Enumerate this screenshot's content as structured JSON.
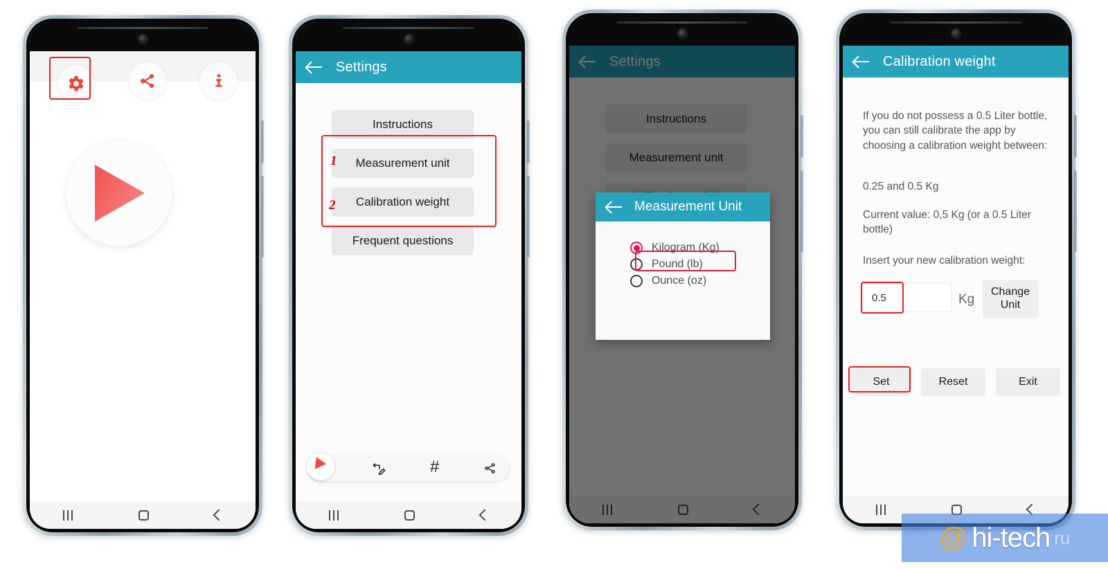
{
  "theme": {
    "teal": "#27a3bb",
    "teal_dim": "#1b5f6d",
    "accent_red": "#ef4a4a",
    "highlight_red": "#ee1c1c",
    "radio_pink": "#d81b60",
    "button_grey": "#e8e8e8"
  },
  "phone1": {
    "name": "home-screen",
    "icons": [
      {
        "name": "gear-icon",
        "label": "Settings"
      },
      {
        "name": "share-icon",
        "label": "Share"
      },
      {
        "name": "info-icon",
        "label": "Info"
      }
    ],
    "play_button_label": "Play",
    "annotation": {
      "target": "gear-icon"
    },
    "navbar": {
      "recent": "Recents",
      "home": "Home",
      "back": "Back"
    }
  },
  "phone2": {
    "name": "settings-screen",
    "appbar": {
      "title": "Settings",
      "back": "Back"
    },
    "buttons": [
      "Instructions",
      "Measurement unit",
      "Calibration weight",
      "Frequent questions"
    ],
    "annotations": {
      "step1": "1",
      "step2": "2"
    },
    "edit_pill": {
      "items": [
        {
          "name": "color-knob-icon",
          "glyph": ""
        },
        {
          "name": "annotate-icon",
          "glyph": "✎"
        },
        {
          "name": "hash-icon",
          "glyph": "#"
        },
        {
          "name": "share-icon",
          "glyph": ""
        }
      ]
    },
    "navbar": {
      "recent": "Recents",
      "home": "Home",
      "back": "Back"
    }
  },
  "phone3": {
    "name": "measurement-unit-dialog-screen",
    "appbar": {
      "title": "Settings",
      "back": "Back"
    },
    "background_buttons": [
      "Instructions",
      "Measurement unit",
      "Calibration weight"
    ],
    "dialog": {
      "title": "Measurement Unit",
      "back": "Back",
      "options": [
        {
          "label": "Kilogram (Kg)",
          "selected": true
        },
        {
          "label": "Pound (lb)",
          "selected": false
        },
        {
          "label": "Ounce (oz)",
          "selected": false
        }
      ]
    },
    "navbar": {
      "recent": "Recents",
      "home": "Home",
      "back": "Back"
    }
  },
  "phone4": {
    "name": "calibration-weight-screen",
    "appbar": {
      "title": "Calibration weight",
      "back": "Back"
    },
    "paragraphs": {
      "intro": "If you do not possess a 0.5 Liter bottle, you can still calibrate the app by choosing a calibration weight between:",
      "range": "0.25 and 0.5 Kg",
      "current": "Current value: 0,5 Kg (or a 0.5 Liter bottle)",
      "prompt": "Insert your new calibration weight:"
    },
    "input": {
      "value": "0.5",
      "placeholder": ""
    },
    "unit_label": "Kg",
    "change_unit_button": "Change\nUnit",
    "change_unit_line1": "Change",
    "change_unit_line2": "Unit",
    "actions": [
      "Set",
      "Reset",
      "Exit"
    ],
    "navbar": {
      "recent": "Recents",
      "home": "Home",
      "back": "Back"
    }
  },
  "watermark": {
    "at": "@",
    "text": "hi-tech",
    "tail": "ru"
  }
}
